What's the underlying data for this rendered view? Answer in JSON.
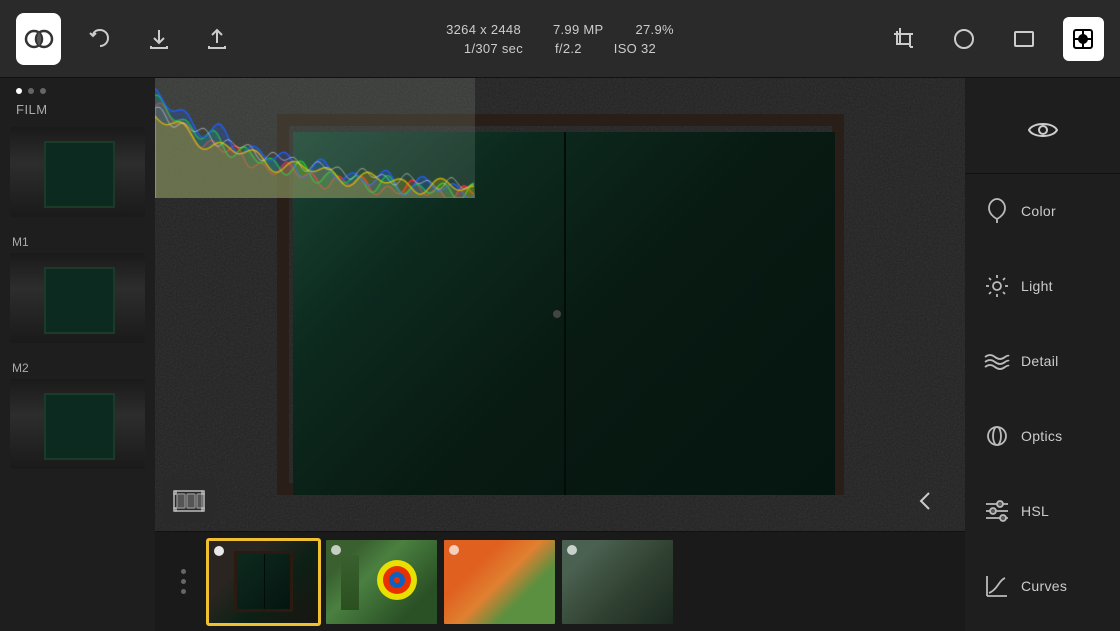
{
  "toolbar": {
    "image_size": "3264 x 2448",
    "megapixels": "7.99 MP",
    "zoom": "27.9%",
    "shutter": "1/307 sec",
    "aperture": "f/2.2",
    "iso": "ISO 32",
    "undo_label": "undo",
    "download_label": "download",
    "share_label": "share"
  },
  "left_panel": {
    "preset_label": "FILM",
    "presets": [
      {
        "name": "",
        "id": "preset-1"
      },
      {
        "name": "M1",
        "id": "preset-m1"
      },
      {
        "name": "M2",
        "id": "preset-m2"
      }
    ]
  },
  "right_panel": {
    "tools": [
      {
        "id": "color",
        "label": "Color",
        "icon": "droplet"
      },
      {
        "id": "light",
        "label": "Light",
        "icon": "sun"
      },
      {
        "id": "detail",
        "label": "Detail",
        "icon": "waves"
      },
      {
        "id": "optics",
        "label": "Optics",
        "icon": "circle"
      },
      {
        "id": "hsl",
        "label": "HSL",
        "icon": "bars"
      },
      {
        "id": "curves",
        "label": "Curves",
        "icon": "curve"
      }
    ]
  },
  "filmstrip": {
    "images": [
      {
        "id": "img-1",
        "selected": true,
        "label": "door"
      },
      {
        "id": "img-2",
        "selected": false,
        "label": "archery"
      },
      {
        "id": "img-3",
        "selected": false,
        "label": "orange-shirt"
      },
      {
        "id": "img-4",
        "selected": false,
        "label": "group"
      }
    ]
  }
}
